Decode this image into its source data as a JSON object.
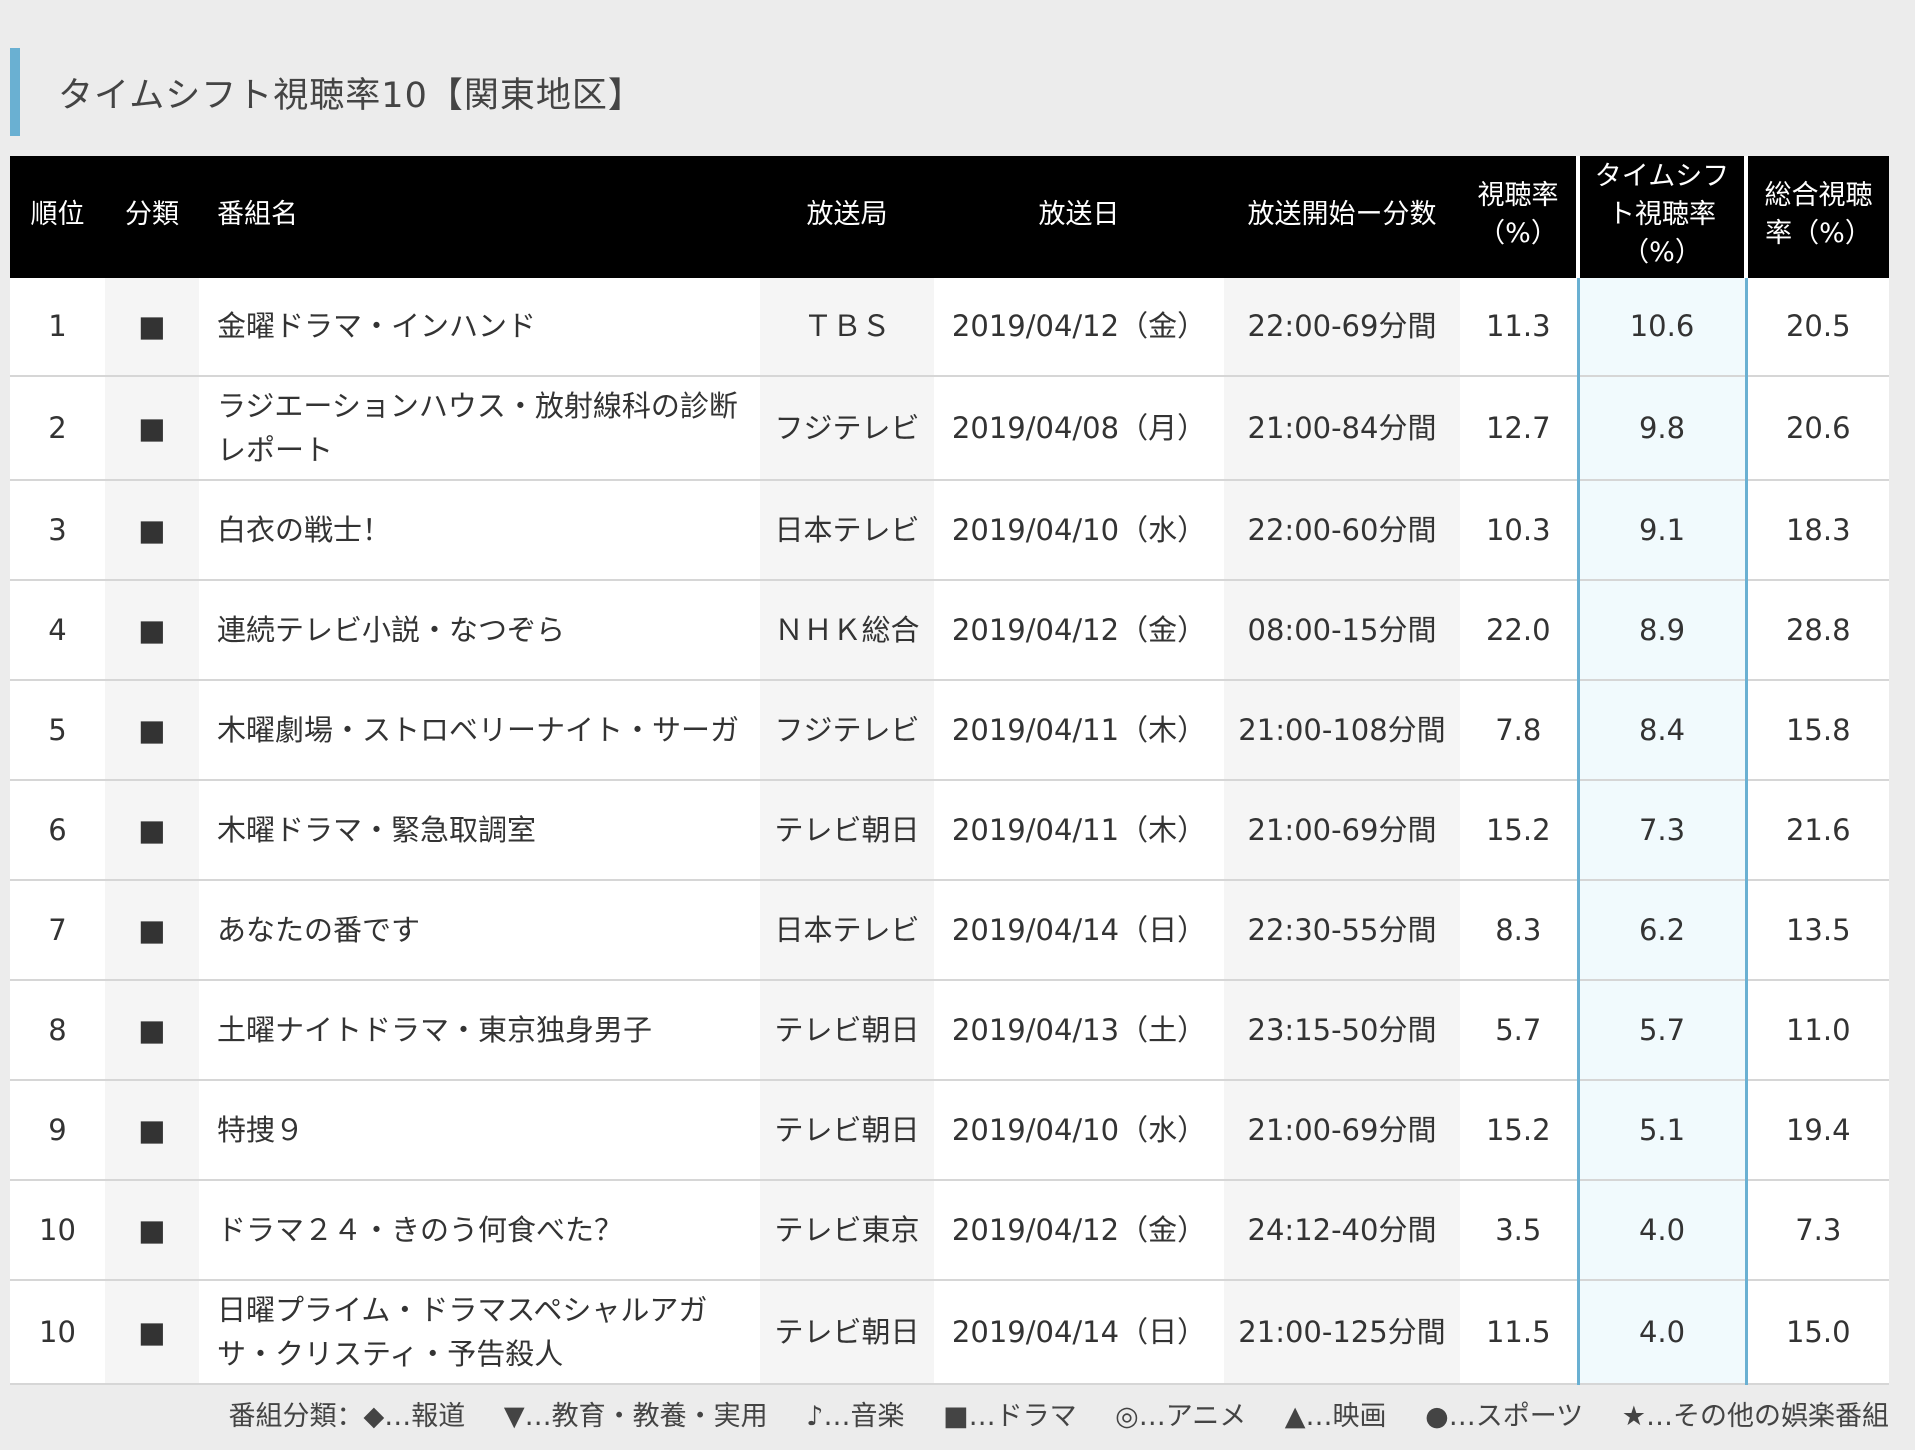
{
  "title": "タイムシフト視聴率10【関東地区】",
  "columns": {
    "rank": "順位",
    "category": "分類",
    "program": "番組名",
    "station": "放送局",
    "date": "放送日",
    "start_duration": "放送開始ー分数",
    "rating": "視聴率（%）",
    "timeshift": "タイムシフト視聴率（%）",
    "total": "総合視聴率（%）"
  },
  "rows": [
    {
      "rank": "1",
      "category": "■",
      "program": "金曜ドラマ・インハンド",
      "station": "ＴＢＳ",
      "date": "2019/04/12（金）",
      "time": "22:00-69分間",
      "rating": "11.3",
      "timeshift": "10.6",
      "total": "20.5"
    },
    {
      "rank": "2",
      "category": "■",
      "program": "ラジエーションハウス・放射線科の診断レポート",
      "station": "フジテレビ",
      "date": "2019/04/08（月）",
      "time": "21:00-84分間",
      "rating": "12.7",
      "timeshift": "9.8",
      "total": "20.6"
    },
    {
      "rank": "3",
      "category": "■",
      "program": "白衣の戦士！",
      "station": "日本テレビ",
      "date": "2019/04/10（水）",
      "time": "22:00-60分間",
      "rating": "10.3",
      "timeshift": "9.1",
      "total": "18.3"
    },
    {
      "rank": "4",
      "category": "■",
      "program": "連続テレビ小説・なつぞら",
      "station": "ＮＨＫ総合",
      "date": "2019/04/12（金）",
      "time": "08:00-15分間",
      "rating": "22.0",
      "timeshift": "8.9",
      "total": "28.8"
    },
    {
      "rank": "5",
      "category": "■",
      "program": "木曜劇場・ストロベリーナイト・サーガ",
      "station": "フジテレビ",
      "date": "2019/04/11（木）",
      "time": "21:00-108分間",
      "rating": "7.8",
      "timeshift": "8.4",
      "total": "15.8"
    },
    {
      "rank": "6",
      "category": "■",
      "program": "木曜ドラマ・緊急取調室",
      "station": "テレビ朝日",
      "date": "2019/04/11（木）",
      "time": "21:00-69分間",
      "rating": "15.2",
      "timeshift": "7.3",
      "total": "21.6"
    },
    {
      "rank": "7",
      "category": "■",
      "program": "あなたの番です",
      "station": "日本テレビ",
      "date": "2019/04/14（日）",
      "time": "22:30-55分間",
      "rating": "8.3",
      "timeshift": "6.2",
      "total": "13.5"
    },
    {
      "rank": "8",
      "category": "■",
      "program": "土曜ナイトドラマ・東京独身男子",
      "station": "テレビ朝日",
      "date": "2019/04/13（土）",
      "time": "23:15-50分間",
      "rating": "5.7",
      "timeshift": "5.7",
      "total": "11.0"
    },
    {
      "rank": "9",
      "category": "■",
      "program": "特捜９",
      "station": "テレビ朝日",
      "date": "2019/04/10（水）",
      "time": "21:00-69分間",
      "rating": "15.2",
      "timeshift": "5.1",
      "total": "19.4"
    },
    {
      "rank": "10",
      "category": "■",
      "program": "ドラマ２４・きのう何食べた？",
      "station": "テレビ東京",
      "date": "2019/04/12（金）",
      "time": "24:12-40分間",
      "rating": "3.5",
      "timeshift": "4.0",
      "total": "7.3"
    },
    {
      "rank": "10",
      "category": "■",
      "program": "日曜プライム・ドラマスペシャルアガサ・クリスティ・予告殺人",
      "station": "テレビ朝日",
      "date": "2019/04/14（日）",
      "time": "21:00-125分間",
      "rating": "11.5",
      "timeshift": "4.0",
      "total": "15.0"
    }
  ],
  "legend": [
    "番組分類：◆…報道",
    "▼…教育・教養・実用",
    "♪…音楽",
    "■…ドラマ",
    "◎…アニメ",
    "▲…映画",
    "●…スポーツ",
    "★…その他の娯楽番組"
  ]
}
